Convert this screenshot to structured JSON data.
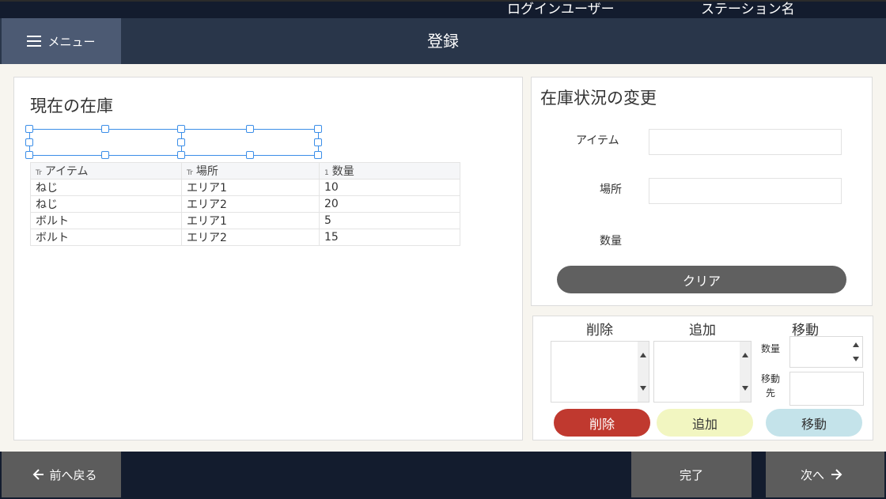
{
  "topbar": {
    "user_label": "ログインユーザー",
    "station_label": "ステーション名"
  },
  "header": {
    "menu_label": "メニュー",
    "title": "登録"
  },
  "inventory": {
    "title": "現在の在庫",
    "columns": [
      {
        "type_icon": "Tr",
        "label": "アイテム"
      },
      {
        "type_icon": "Tr",
        "label": "場所"
      },
      {
        "type_icon": "1",
        "label": "数量"
      }
    ],
    "rows": [
      {
        "item": "ねじ",
        "location": "エリア1",
        "qty": "10"
      },
      {
        "item": "ねじ",
        "location": "エリア2",
        "qty": "20"
      },
      {
        "item": "ボルト",
        "location": "エリア1",
        "qty": "5"
      },
      {
        "item": "ボルト",
        "location": "エリア2",
        "qty": "15"
      }
    ]
  },
  "status_change": {
    "title": "在庫状況の変更",
    "item_label": "アイテム",
    "location_label": "場所",
    "qty_label": "数量",
    "clear_label": "クリア"
  },
  "actions": {
    "delete_header": "削除",
    "add_header": "追加",
    "move_header": "移動",
    "qty_label": "数量",
    "move_to_label_1": "移動",
    "move_to_label_2": "先",
    "delete_button": "削除",
    "add_button": "追加",
    "move_button": "移動",
    "colors": {
      "delete": "#c0392f",
      "add": "#f2f6c1",
      "move": "#c4e3ea"
    }
  },
  "footer": {
    "back_label": "前へ戻る",
    "done_label": "完了",
    "next_label": "次へ"
  }
}
